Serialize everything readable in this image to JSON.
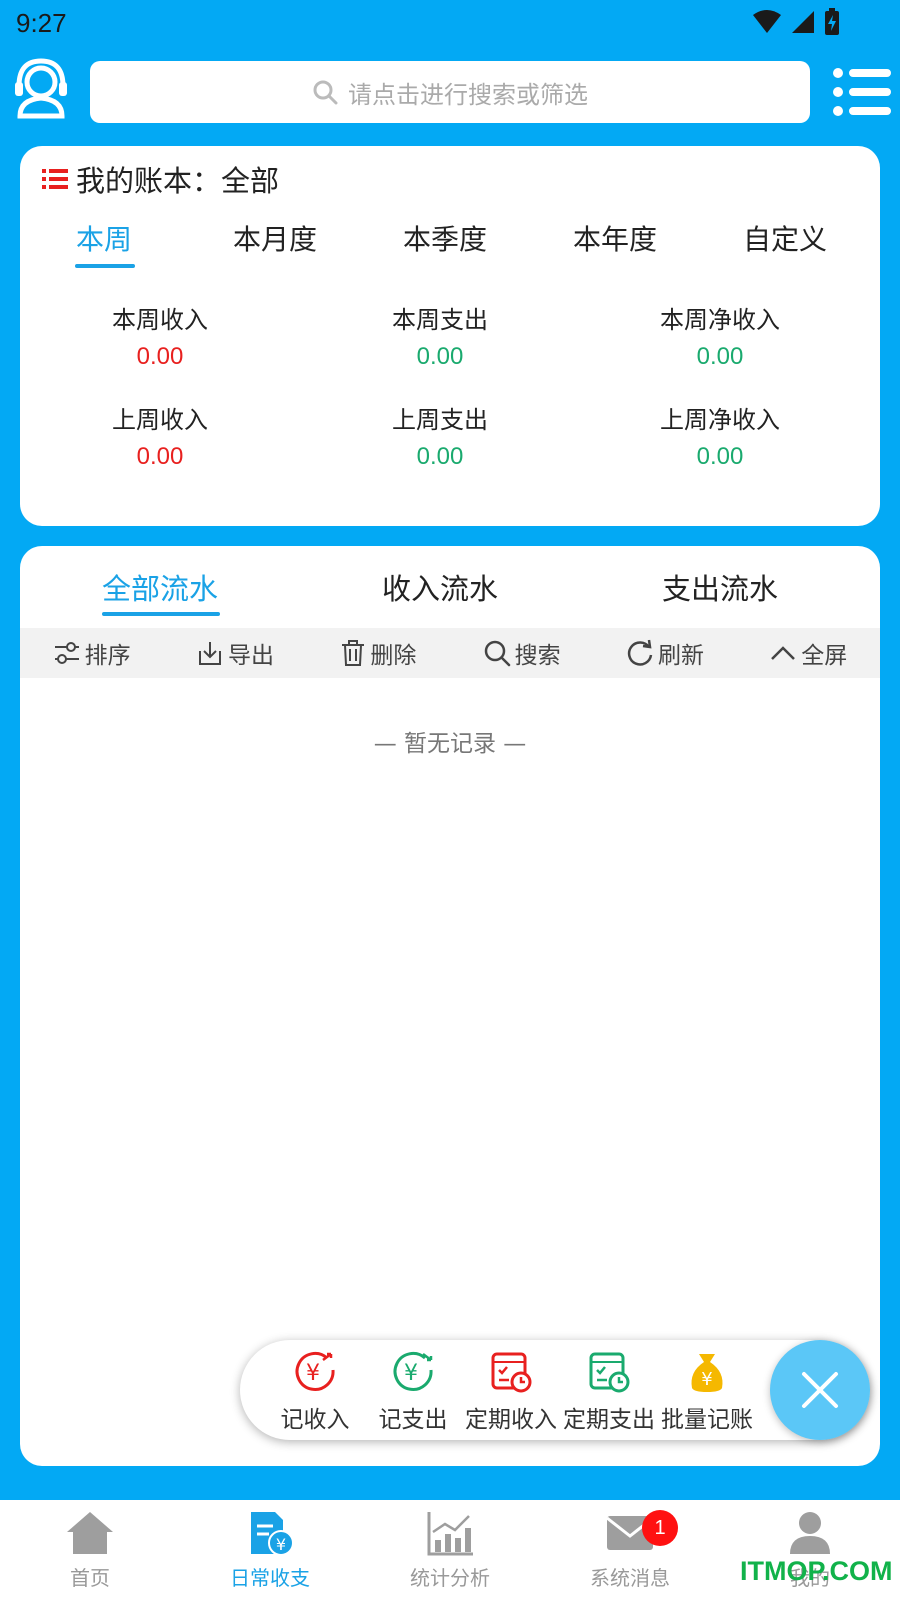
{
  "status_bar": {
    "time": "9:27"
  },
  "header": {
    "search_placeholder": "请点击进行搜索或筛选"
  },
  "ledger": {
    "label": "我的账本：全部",
    "tabs": [
      "本周",
      "本月度",
      "本季度",
      "本年度",
      "自定义"
    ],
    "active_tab": "本周",
    "stats": [
      {
        "label": "本周收入",
        "value": "0.00"
      },
      {
        "label": "本周支出",
        "value": "0.00"
      },
      {
        "label": "本周净收入",
        "value": "0.00"
      },
      {
        "label": "上周收入",
        "value": "0.00"
      },
      {
        "label": "上周支出",
        "value": "0.00"
      },
      {
        "label": "上周净收入",
        "value": "0.00"
      }
    ]
  },
  "flow": {
    "tabs": [
      "全部流水",
      "收入流水",
      "支出流水"
    ],
    "active_tab": "全部流水",
    "toolbar": [
      "排序",
      "导出",
      "删除",
      "搜索",
      "刷新",
      "全屏"
    ],
    "empty_text": "— 暂无记录 —"
  },
  "quick_actions": [
    "记收入",
    "记支出",
    "定期收入",
    "定期支出",
    "批量记账"
  ],
  "bottom_nav": [
    {
      "label": "首页",
      "icon": "home-icon"
    },
    {
      "label": "日常收支",
      "icon": "daily-bill-icon"
    },
    {
      "label": "统计分析",
      "icon": "chart-icon"
    },
    {
      "label": "系统消息",
      "icon": "mail-icon",
      "badge": "1"
    },
    {
      "label": "我的",
      "icon": "person-icon"
    }
  ],
  "active_nav": "日常收支",
  "watermark": "ITMOP.COM",
  "colors": {
    "primary": "#03a9f4",
    "accent": "#1aa2e6",
    "income": "#e8201f",
    "expense": "#1aaa6e",
    "batch": "#f5b800"
  }
}
